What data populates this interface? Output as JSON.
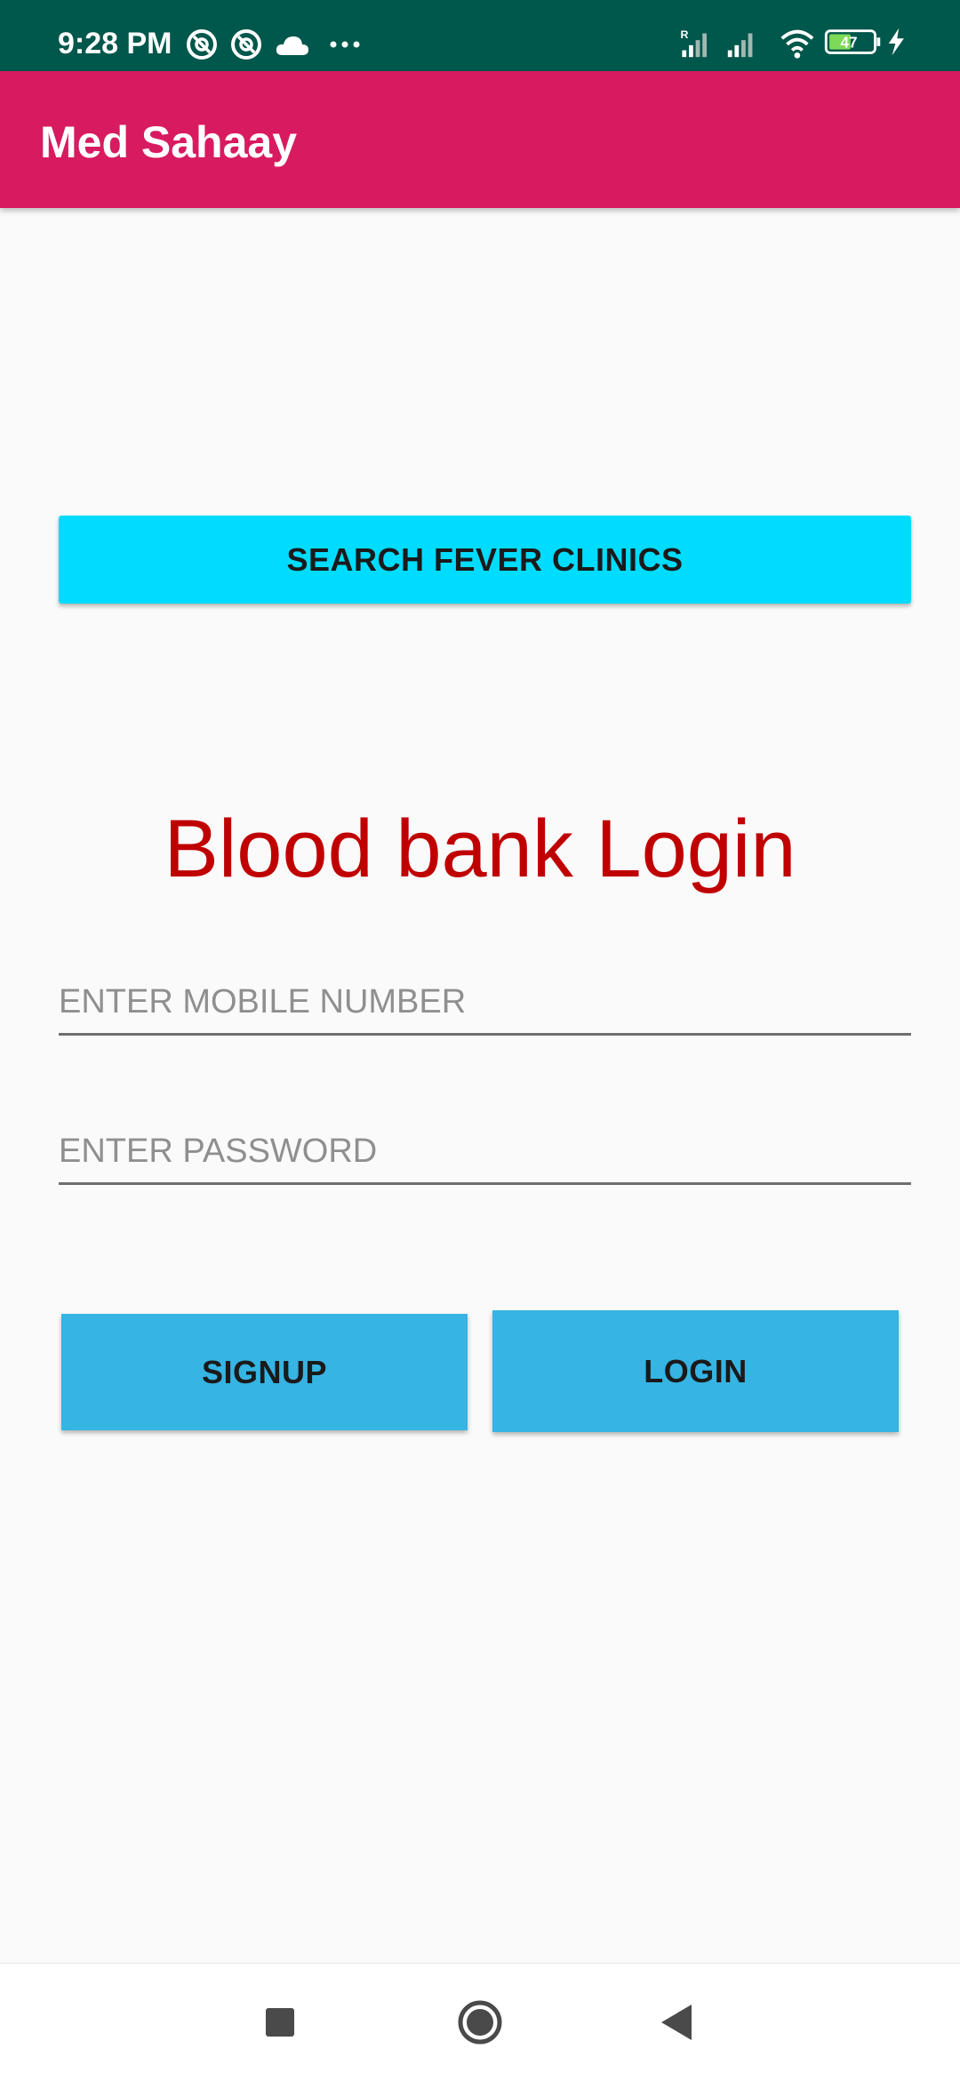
{
  "status_bar": {
    "time": "9:28 PM",
    "battery_level": "47",
    "background_color": "#00574b",
    "left_icons": [
      "at-sign-icon",
      "at-sign-icon",
      "cloud-icon",
      "more-dots-icon"
    ],
    "right_icons": [
      "signal-roaming-icon",
      "signal-icon",
      "wifi-icon",
      "battery-icon",
      "charging-bolt-icon"
    ]
  },
  "app_bar": {
    "title": "Med Sahaay",
    "background_color": "#d81b60"
  },
  "main": {
    "search_button_label": "SEARCH FEVER CLINICS",
    "search_button_color": "#00dcff",
    "heading": "Blood bank Login",
    "heading_color": "#c00000",
    "mobile_field": {
      "placeholder": "ENTER MOBILE NUMBER",
      "value": ""
    },
    "password_field": {
      "placeholder": "ENTER PASSWORD",
      "value": ""
    },
    "signup_label": "SIGNUP",
    "login_label": "LOGIN",
    "action_button_color": "#36b4e3"
  },
  "nav_bar": {
    "items": [
      "recent-apps-icon",
      "home-icon",
      "back-icon"
    ]
  }
}
